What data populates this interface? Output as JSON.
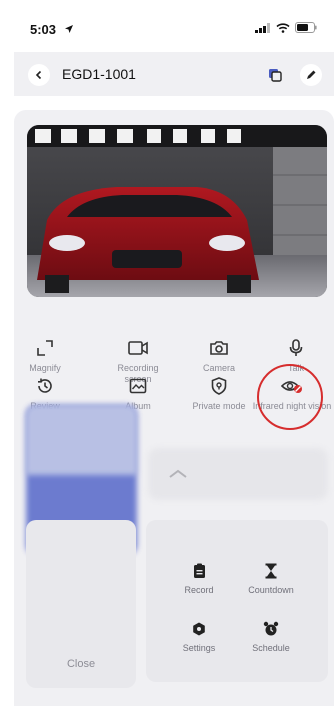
{
  "status": {
    "time": "5:03"
  },
  "nav": {
    "title": "EGD1-1001"
  },
  "controls": [
    {
      "label": "Magnify",
      "icon": "magnify-icon"
    },
    {
      "label": "Recording screen",
      "icon": "video-camera-icon"
    },
    {
      "label": "Camera",
      "icon": "camera-icon"
    },
    {
      "label": "Talk",
      "icon": "microphone-icon"
    },
    {
      "label": "Review",
      "icon": "history-icon"
    },
    {
      "label": "Album",
      "icon": "album-icon"
    },
    {
      "label": "Private mode",
      "icon": "shield-icon"
    },
    {
      "label": "Infrared night vision",
      "icon": "infrared-eye-icon"
    }
  ],
  "close": {
    "label": "Close"
  },
  "menu": [
    {
      "label": "Record",
      "icon": "clipboard-icon"
    },
    {
      "label": "Countdown",
      "icon": "hourglass-icon"
    },
    {
      "label": "Settings",
      "icon": "hexagon-icon"
    },
    {
      "label": "Schedule",
      "icon": "alarm-clock-icon"
    }
  ],
  "colors": {
    "accent": "#d62d2d",
    "blue": "#5566c8",
    "text_muted": "#8b8b95"
  }
}
